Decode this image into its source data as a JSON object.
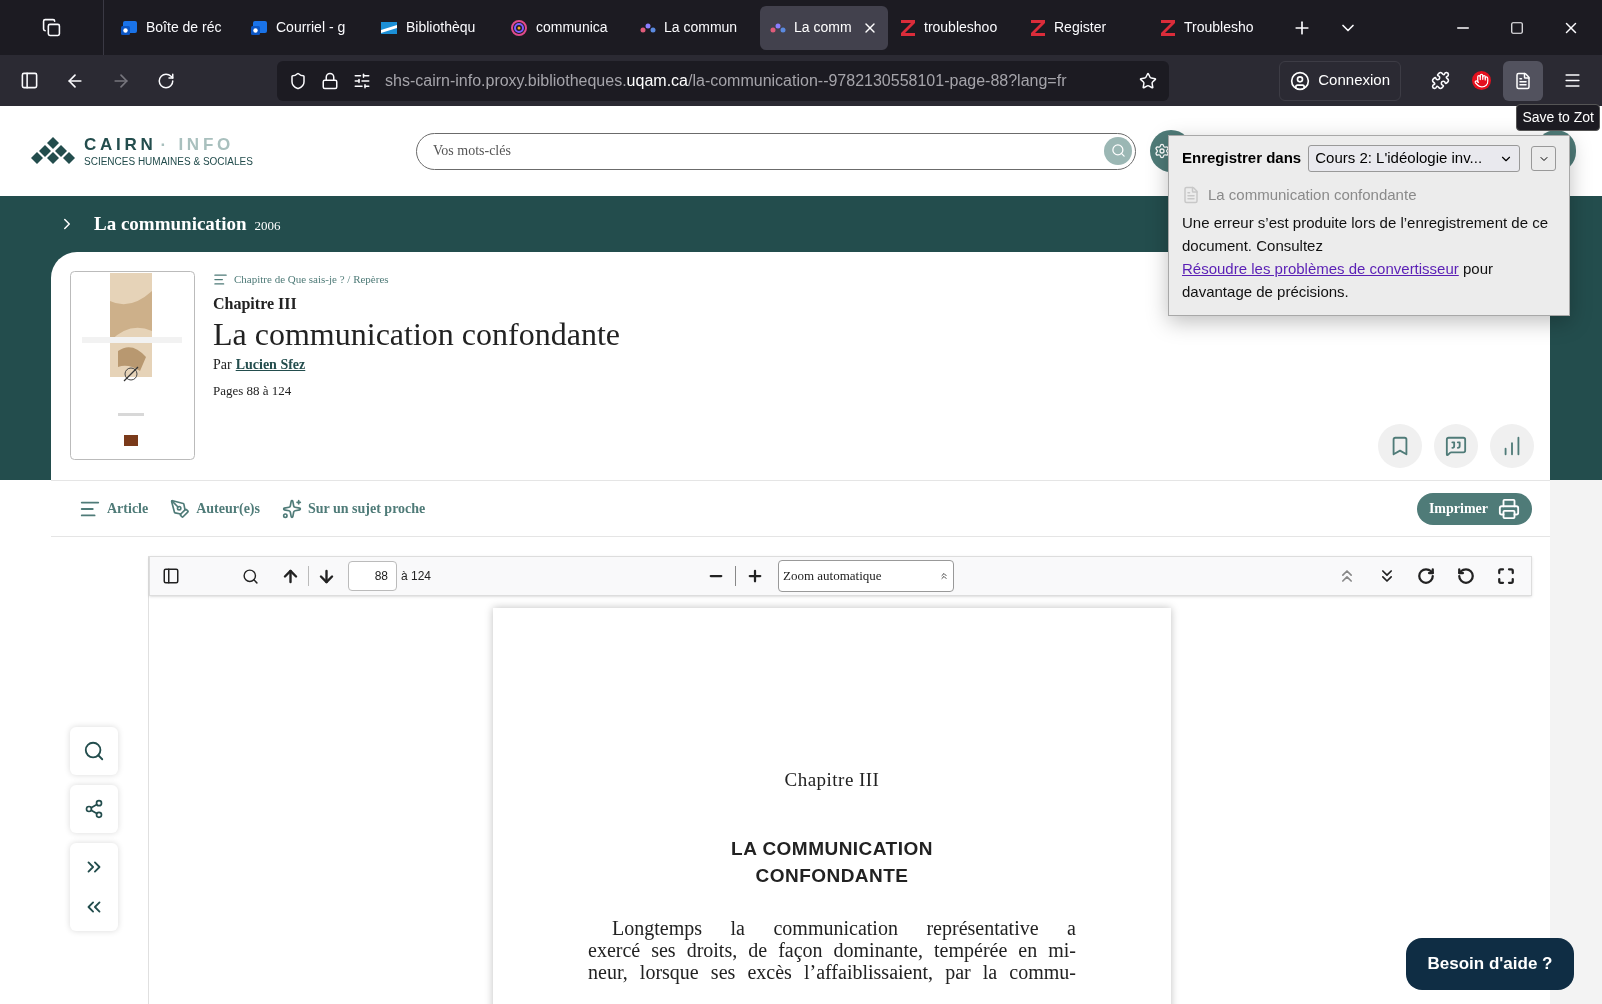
{
  "browser": {
    "tabs": [
      {
        "label": "Boîte de réc",
        "kind": "mail",
        "selected": false
      },
      {
        "label": "Courriel - g",
        "kind": "mail",
        "selected": false
      },
      {
        "label": "Bibliothèqu",
        "kind": "flag",
        "selected": false
      },
      {
        "label": "communica",
        "kind": "spiral",
        "selected": false
      },
      {
        "label": "La commun",
        "kind": "dots",
        "selected": false
      },
      {
        "label": "La comm",
        "kind": "dots",
        "selected": true
      },
      {
        "label": "troubleshoo",
        "kind": "z",
        "selected": false
      },
      {
        "label": "Register",
        "kind": "z",
        "selected": false
      },
      {
        "label": "Troublesho",
        "kind": "z",
        "selected": false
      }
    ],
    "url": {
      "prefix": "shs-cairn-info.proxy.bibliotheques.",
      "domain": "uqam.ca",
      "path": "/la-communication--9782130558101-page-88?lang=fr"
    },
    "account_button": "Connexion",
    "tooltip": "Save to Zot"
  },
  "site": {
    "logo": {
      "name": "CAIRN",
      "suffix": "· INFO",
      "tagline": "SCIENCES HUMAINES & SOCIALES"
    },
    "search": {
      "placeholder": "Vos mots-clés"
    },
    "breadcrumb": {
      "title": "La communication",
      "year": "2006"
    },
    "article": {
      "kind_label": "Chapitre de Que sais-je ? / Repères",
      "chapter": "Chapitre III",
      "title": "La communication confondante",
      "by": "Par",
      "author": "Lucien Sfez",
      "pages": "Pages 88 à 124"
    },
    "nav": [
      {
        "label": "Article",
        "kind": "lines"
      },
      {
        "label": "Auteur(e)s",
        "kind": "pen"
      },
      {
        "label": "Sur un sujet proche",
        "kind": "sparkles"
      }
    ],
    "print_button": "Imprimer",
    "help_button": "Besoin d'aide ?"
  },
  "pdf": {
    "toolbar": {
      "page": "88",
      "page_count": "à 124",
      "zoom": "Zoom automatique"
    },
    "page": {
      "chapter": "Chapitre III",
      "title_lines": [
        "LA COMMUNICATION",
        "CONFONDANTE"
      ],
      "paragraph_lines": [
        {
          "text": "Longtemps la communication représentative a",
          "indent": true
        },
        {
          "text": "exercé ses droits, de façon dominante, tempérée en mi-",
          "indent": false
        },
        {
          "text": "neur, lorsque ses excès l’affaiblissaient, par la commu-",
          "indent": false
        }
      ]
    }
  },
  "zotero_popup": {
    "label": "Enregistrer dans",
    "collection": "Cours 2: L'idéologie inv...",
    "item": "La communication confondante",
    "message_before": "Une erreur s’est produite lors de l’enregistrement de ce document. Consultez ",
    "link": "Résoudre les problèmes de convertisseur",
    "message_after": " pour davantage de précisions."
  }
}
